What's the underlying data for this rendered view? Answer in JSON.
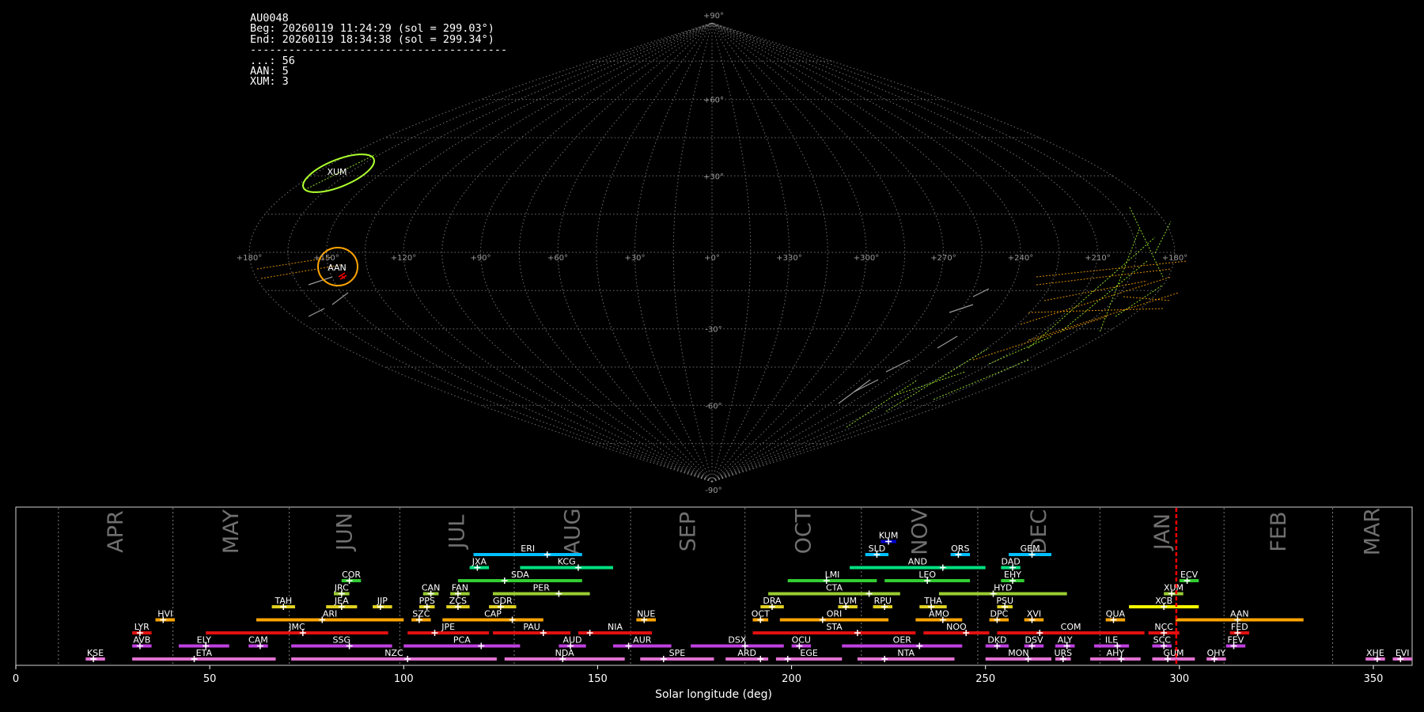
{
  "info": {
    "id": "AU0048",
    "beg": "Beg: 20260119 11:24:29 (sol = 299.03°)",
    "end": "End: 20260119 18:34:38 (sol = 299.34°)",
    "separator": "----------------------------------------",
    "counts": [
      {
        "label": "...",
        "value": 56
      },
      {
        "label": "AAN",
        "value": 5
      },
      {
        "label": "XUM",
        "value": 3
      }
    ]
  },
  "colors": {
    "background": "#000000",
    "grid": "#8c8c8c",
    "marker": "#ff0000",
    "AAN": "#ffa500",
    "XUM": "#adff2f"
  },
  "sky_map": {
    "projection": "sinusoidal",
    "lon_ticks": [
      "+180°",
      "+150°",
      "+120°",
      "+90°",
      "+60°",
      "+30°",
      "+0°",
      "+330°",
      "+300°",
      "+270°",
      "+240°",
      "+210°",
      "+180°"
    ],
    "lat_ticks": [
      "+90°",
      "+60°",
      "+30°",
      "-30°",
      "-60°",
      "-90°"
    ],
    "showers": [
      {
        "name": "XUM",
        "color": "#adff2f"
      },
      {
        "name": "AAN",
        "color": "#ffa500"
      }
    ]
  },
  "chart_data": {
    "type": "bar",
    "title": "",
    "xlabel": "Solar longitude (deg)",
    "ylabel": "",
    "xlim": [
      0,
      360
    ],
    "xticks": [
      0,
      50,
      100,
      150,
      200,
      250,
      300,
      350
    ],
    "current_sol": 299.2,
    "months": [
      {
        "name": "APR",
        "start": 11
      },
      {
        "name": "MAY",
        "start": 40.5
      },
      {
        "name": "JUN",
        "start": 70.5
      },
      {
        "name": "JUL",
        "start": 99
      },
      {
        "name": "AUG",
        "start": 128.5
      },
      {
        "name": "SEP",
        "start": 158.5
      },
      {
        "name": "OCT",
        "start": 188
      },
      {
        "name": "NOV",
        "start": 218
      },
      {
        "name": "DEC",
        "start": 248
      },
      {
        "name": "JAN",
        "start": 279.5
      },
      {
        "name": "FEB",
        "start": 311.5
      },
      {
        "name": "MAR",
        "start": 339.5
      }
    ],
    "showers": [
      {
        "code": "KUM",
        "start": 223,
        "end": 227,
        "peak": 225,
        "row": 9,
        "color": "#0000cd"
      },
      {
        "code": "ERI",
        "start": 118,
        "end": 146,
        "peak": 137,
        "row": 8,
        "color": "#00bfff"
      },
      {
        "code": "SLD",
        "start": 219,
        "end": 225,
        "peak": 222,
        "row": 8,
        "color": "#00bfff"
      },
      {
        "code": "ORS",
        "start": 241,
        "end": 246,
        "peak": 243,
        "row": 8,
        "color": "#00bfff"
      },
      {
        "code": "GEM",
        "start": 256,
        "end": 267,
        "peak": 262,
        "row": 8,
        "color": "#00bfff"
      },
      {
        "code": "JXA",
        "start": 117,
        "end": 122,
        "peak": 119,
        "row": 7,
        "color": "#00e080"
      },
      {
        "code": "KCG",
        "start": 130,
        "end": 154,
        "peak": 145,
        "row": 7,
        "color": "#00e080"
      },
      {
        "code": "AND",
        "start": 215,
        "end": 250,
        "peak": 239,
        "row": 7,
        "color": "#00e080"
      },
      {
        "code": "DAD",
        "start": 254,
        "end": 259,
        "peak": 257,
        "row": 7,
        "color": "#00e080"
      },
      {
        "code": "COR",
        "start": 84,
        "end": 89,
        "peak": 86,
        "row": 6,
        "color": "#32cd32"
      },
      {
        "code": "SDA",
        "start": 114,
        "end": 146,
        "peak": 126,
        "row": 6,
        "color": "#32cd32"
      },
      {
        "code": "LMI",
        "start": 199,
        "end": 222,
        "peak": 209,
        "row": 6,
        "color": "#32cd32"
      },
      {
        "code": "LEO",
        "start": 224,
        "end": 246,
        "peak": 235,
        "row": 6,
        "color": "#32cd32"
      },
      {
        "code": "EHY",
        "start": 254,
        "end": 260,
        "peak": 257,
        "row": 6,
        "color": "#32cd32"
      },
      {
        "code": "ECV",
        "start": 300,
        "end": 305,
        "peak": 302,
        "row": 6,
        "color": "#32cd32"
      },
      {
        "code": "JRC",
        "start": 82,
        "end": 86,
        "peak": 84,
        "row": 5,
        "color": "#9acd32"
      },
      {
        "code": "CAN",
        "start": 105,
        "end": 109,
        "peak": 107,
        "row": 5,
        "color": "#9acd32"
      },
      {
        "code": "FAN",
        "start": 112,
        "end": 117,
        "peak": 114,
        "row": 5,
        "color": "#9acd32"
      },
      {
        "code": "PER",
        "start": 123,
        "end": 148,
        "peak": 140,
        "row": 5,
        "color": "#9acd32"
      },
      {
        "code": "CTA",
        "start": 194,
        "end": 228,
        "peak": 220,
        "row": 5,
        "color": "#9acd32"
      },
      {
        "code": "HYD",
        "start": 238,
        "end": 271,
        "peak": 252,
        "row": 5,
        "color": "#9acd32"
      },
      {
        "code": "XUM",
        "start": 296,
        "end": 301,
        "peak": 298,
        "row": 5,
        "color": "#9acd32"
      },
      {
        "code": "TAH",
        "start": 66,
        "end": 72,
        "peak": 69,
        "row": 4,
        "color": "#e0d020"
      },
      {
        "code": "JEA",
        "start": 80,
        "end": 88,
        "peak": 84,
        "row": 4,
        "color": "#e0d020"
      },
      {
        "code": "JIP",
        "start": 92,
        "end": 97,
        "peak": 94,
        "row": 4,
        "color": "#e0d020"
      },
      {
        "code": "PPS",
        "start": 104,
        "end": 108,
        "peak": 106,
        "row": 4,
        "color": "#e0d020"
      },
      {
        "code": "ZCS",
        "start": 111,
        "end": 117,
        "peak": 114,
        "row": 4,
        "color": "#e0d020"
      },
      {
        "code": "GDR",
        "start": 122,
        "end": 129,
        "peak": 125,
        "row": 4,
        "color": "#e0d020"
      },
      {
        "code": "DRA",
        "start": 192,
        "end": 198,
        "peak": 195,
        "row": 4,
        "color": "#e0d020"
      },
      {
        "code": "LUM",
        "start": 212,
        "end": 217,
        "peak": 214,
        "row": 4,
        "color": "#e0d020"
      },
      {
        "code": "RPU",
        "start": 221,
        "end": 226,
        "peak": 224,
        "row": 4,
        "color": "#e0d020"
      },
      {
        "code": "THA",
        "start": 233,
        "end": 240,
        "peak": 236,
        "row": 4,
        "color": "#e0d020"
      },
      {
        "code": "PSU",
        "start": 253,
        "end": 257,
        "peak": 255,
        "row": 4,
        "color": "#e0d020"
      },
      {
        "code": "XCB",
        "start": 287,
        "end": 305,
        "peak": 296,
        "row": 4,
        "color": "#ffff00"
      },
      {
        "code": "HVI",
        "start": 36,
        "end": 41,
        "peak": 38,
        "row": 3,
        "color": "#ffa500"
      },
      {
        "code": "ARI",
        "start": 62,
        "end": 100,
        "peak": 79,
        "row": 3,
        "color": "#ffa500"
      },
      {
        "code": "SZC",
        "start": 102,
        "end": 107,
        "peak": 104,
        "row": 3,
        "color": "#ffa500"
      },
      {
        "code": "CAP",
        "start": 110,
        "end": 136,
        "peak": 128,
        "row": 3,
        "color": "#ffa500"
      },
      {
        "code": "NUE",
        "start": 160,
        "end": 165,
        "peak": 162,
        "row": 3,
        "color": "#ffa500"
      },
      {
        "code": "OCT",
        "start": 190,
        "end": 194,
        "peak": 192,
        "row": 3,
        "color": "#ffa500"
      },
      {
        "code": "ORI",
        "start": 197,
        "end": 225,
        "peak": 208,
        "row": 3,
        "color": "#ffa500"
      },
      {
        "code": "AMO",
        "start": 232,
        "end": 244,
        "peak": 239,
        "row": 3,
        "color": "#ffa500"
      },
      {
        "code": "DPC",
        "start": 251,
        "end": 256,
        "peak": 253,
        "row": 3,
        "color": "#ffa500"
      },
      {
        "code": "XVI",
        "start": 260,
        "end": 265,
        "peak": 262,
        "row": 3,
        "color": "#ffa500"
      },
      {
        "code": "QUA",
        "start": 281,
        "end": 286,
        "peak": 283,
        "row": 3,
        "color": "#ffa500"
      },
      {
        "code": "AAN",
        "start": 299,
        "end": 332,
        "peak": 315,
        "row": 3,
        "color": "#ffa500"
      },
      {
        "code": "LYR",
        "start": 30,
        "end": 35,
        "peak": 32,
        "row": 2,
        "color": "#e01010"
      },
      {
        "code": "JMC",
        "start": 49,
        "end": 96,
        "peak": 74,
        "row": 2,
        "color": "#e01010"
      },
      {
        "code": "JPE",
        "start": 101,
        "end": 122,
        "peak": 108,
        "row": 2,
        "color": "#e01010"
      },
      {
        "code": "PAU",
        "start": 123,
        "end": 143,
        "peak": 136,
        "row": 2,
        "color": "#e01010"
      },
      {
        "code": "NIA",
        "start": 145,
        "end": 164,
        "peak": 148,
        "row": 2,
        "color": "#e01010"
      },
      {
        "code": "STA",
        "start": 190,
        "end": 232,
        "peak": 217,
        "row": 2,
        "color": "#e01010"
      },
      {
        "code": "NOO",
        "start": 234,
        "end": 251,
        "peak": 245,
        "row": 2,
        "color": "#e01010"
      },
      {
        "code": "COM",
        "start": 253,
        "end": 291,
        "peak": 264,
        "row": 2,
        "color": "#e01010"
      },
      {
        "code": "NCC",
        "start": 292,
        "end": 300,
        "peak": 296,
        "row": 2,
        "color": "#e01010"
      },
      {
        "code": "FED",
        "start": 313,
        "end": 318,
        "peak": 315,
        "row": 2,
        "color": "#e01010"
      },
      {
        "code": "AVB",
        "start": 30,
        "end": 35,
        "peak": 32,
        "row": 1,
        "color": "#c040e0"
      },
      {
        "code": "ELY",
        "start": 42,
        "end": 55,
        "peak": 49,
        "row": 1,
        "color": "#c040e0"
      },
      {
        "code": "CAM",
        "start": 60,
        "end": 65,
        "peak": 63,
        "row": 1,
        "color": "#c040e0"
      },
      {
        "code": "SSG",
        "start": 71,
        "end": 97,
        "peak": 86,
        "row": 1,
        "color": "#c040e0"
      },
      {
        "code": "PCA",
        "start": 100,
        "end": 130,
        "peak": 120,
        "row": 1,
        "color": "#c040e0"
      },
      {
        "code": "AUD",
        "start": 140,
        "end": 147,
        "peak": 143,
        "row": 1,
        "color": "#c040e0"
      },
      {
        "code": "AUR",
        "start": 154,
        "end": 169,
        "peak": 158,
        "row": 1,
        "color": "#c040e0"
      },
      {
        "code": "DSX",
        "start": 174,
        "end": 198,
        "peak": 188,
        "row": 1,
        "color": "#c040e0"
      },
      {
        "code": "OCU",
        "start": 200,
        "end": 205,
        "peak": 202,
        "row": 1,
        "color": "#c040e0"
      },
      {
        "code": "OER",
        "start": 213,
        "end": 244,
        "peak": 233,
        "row": 1,
        "color": "#c040e0"
      },
      {
        "code": "DKD",
        "start": 250,
        "end": 256,
        "peak": 253,
        "row": 1,
        "color": "#c040e0"
      },
      {
        "code": "DSV",
        "start": 260,
        "end": 265,
        "peak": 262,
        "row": 1,
        "color": "#c040e0"
      },
      {
        "code": "ALY",
        "start": 268,
        "end": 273,
        "peak": 271,
        "row": 1,
        "color": "#c040e0"
      },
      {
        "code": "ILE",
        "start": 278,
        "end": 287,
        "peak": 284,
        "row": 1,
        "color": "#c040e0"
      },
      {
        "code": "SCC",
        "start": 293,
        "end": 298,
        "peak": 296,
        "row": 1,
        "color": "#c040e0"
      },
      {
        "code": "FEV",
        "start": 312,
        "end": 317,
        "peak": 314,
        "row": 1,
        "color": "#c040e0"
      },
      {
        "code": "KSE",
        "start": 18,
        "end": 23,
        "peak": 20,
        "row": 0,
        "color": "#e070d0"
      },
      {
        "code": "ETA",
        "start": 30,
        "end": 67,
        "peak": 46,
        "row": 0,
        "color": "#e070d0"
      },
      {
        "code": "NZC",
        "start": 71,
        "end": 124,
        "peak": 101,
        "row": 0,
        "color": "#e070d0"
      },
      {
        "code": "NDA",
        "start": 126,
        "end": 157,
        "peak": 141,
        "row": 0,
        "color": "#e070d0"
      },
      {
        "code": "SPE",
        "start": 161,
        "end": 180,
        "peak": 167,
        "row": 0,
        "color": "#e070d0"
      },
      {
        "code": "ARD",
        "start": 183,
        "end": 194,
        "peak": 192,
        "row": 0,
        "color": "#e070d0"
      },
      {
        "code": "EGE",
        "start": 196,
        "end": 213,
        "peak": 199,
        "row": 0,
        "color": "#e070d0"
      },
      {
        "code": "NTA",
        "start": 217,
        "end": 242,
        "peak": 224,
        "row": 0,
        "color": "#e070d0"
      },
      {
        "code": "MON",
        "start": 250,
        "end": 267,
        "peak": 261,
        "row": 0,
        "color": "#e070d0"
      },
      {
        "code": "URS",
        "start": 268,
        "end": 272,
        "peak": 270,
        "row": 0,
        "color": "#e070d0"
      },
      {
        "code": "AHY",
        "start": 277,
        "end": 290,
        "peak": 285,
        "row": 0,
        "color": "#e070d0"
      },
      {
        "code": "GUM",
        "start": 293,
        "end": 304,
        "peak": 297,
        "row": 0,
        "color": "#e070d0"
      },
      {
        "code": "OHY",
        "start": 307,
        "end": 312,
        "peak": 309,
        "row": 0,
        "color": "#e070d0"
      },
      {
        "code": "XHE",
        "start": 348,
        "end": 353,
        "peak": 351,
        "row": 0,
        "color": "#e070d0"
      },
      {
        "code": "EVI",
        "start": 355,
        "end": 360,
        "peak": 357,
        "row": 0,
        "color": "#e070d0"
      }
    ]
  }
}
